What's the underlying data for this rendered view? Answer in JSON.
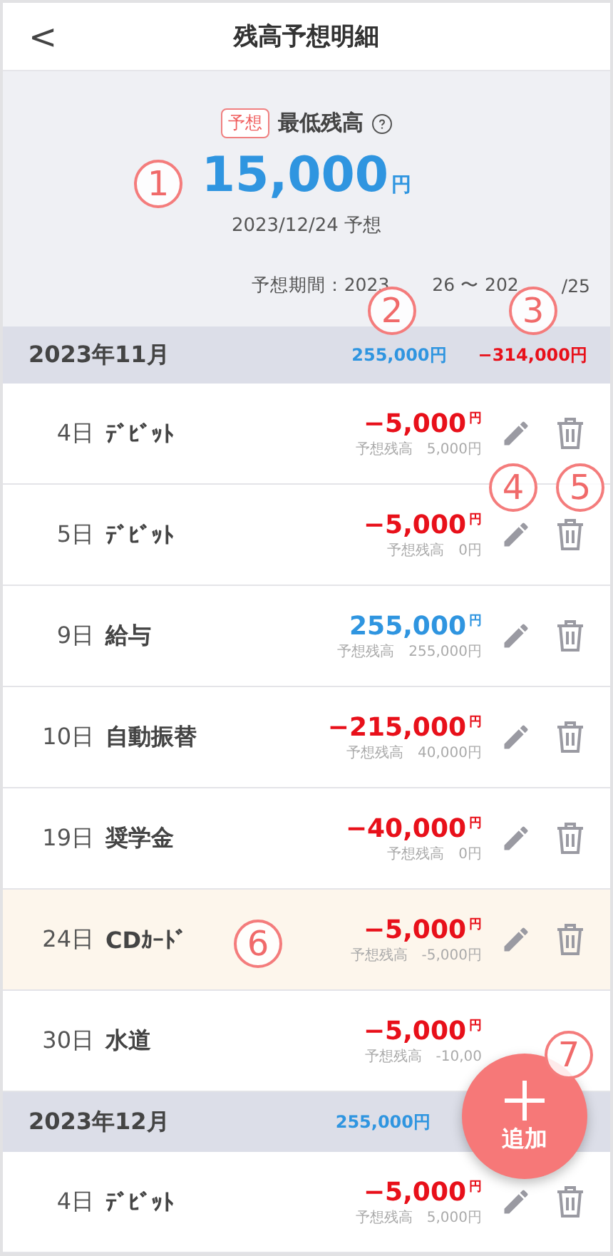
{
  "header": {
    "back": "<",
    "title": "残高予想明細"
  },
  "summary": {
    "badge": "予想",
    "label": "最低残高",
    "amount": "15,000",
    "unit": "円",
    "date": "2023/12/24 予想",
    "period_parts": [
      "予想期間：2023",
      "26 〜 202",
      "/25"
    ]
  },
  "months": [
    {
      "title": "2023年11月",
      "income": "255,000円",
      "expense": "−314,000円",
      "rows": [
        {
          "day": "4日",
          "name": "ﾃﾞﾋﾞｯﾄ",
          "amount": "−5,000",
          "unit": "円",
          "kind": "expense",
          "forecast": "予想残高　5,000円",
          "highlighted": false,
          "actions_visible": true
        },
        {
          "day": "5日",
          "name": "ﾃﾞﾋﾞｯﾄ",
          "amount": "−5,000",
          "unit": "円",
          "kind": "expense",
          "forecast": "予想残高　0円",
          "highlighted": false,
          "actions_visible": true
        },
        {
          "day": "9日",
          "name": "給与",
          "amount": "255,000",
          "unit": "円",
          "kind": "income",
          "forecast": "予想残高　255,000円",
          "highlighted": false,
          "actions_visible": true
        },
        {
          "day": "10日",
          "name": "自動振替",
          "amount": "−215,000",
          "unit": "円",
          "kind": "expense",
          "forecast": "予想残高　40,000円",
          "highlighted": false,
          "actions_visible": true
        },
        {
          "day": "19日",
          "name": "奨学金",
          "amount": "−40,000",
          "unit": "円",
          "kind": "expense",
          "forecast": "予想残高　0円",
          "highlighted": false,
          "actions_visible": true
        },
        {
          "day": "24日",
          "name": "CDｶｰﾄﾞ",
          "amount": "−5,000",
          "unit": "円",
          "kind": "expense",
          "forecast": "予想残高　-5,000円",
          "highlighted": true,
          "actions_visible": true
        },
        {
          "day": "30日",
          "name": "水道",
          "amount": "−5,000",
          "unit": "円",
          "kind": "expense",
          "forecast": "予想残高　-10,00",
          "highlighted": false,
          "actions_visible": false
        }
      ]
    },
    {
      "title": "2023年12月",
      "income": "255,000円",
      "rows": [
        {
          "day": "4日",
          "name": "ﾃﾞﾋﾞｯﾄ",
          "amount": "−5,000",
          "unit": "円",
          "kind": "expense",
          "forecast": "予想残高　5,000円",
          "highlighted": false,
          "actions_visible": true
        }
      ]
    }
  ],
  "fab": {
    "label": "追加"
  },
  "callouts": [
    "1",
    "2",
    "3",
    "4",
    "5",
    "6",
    "7"
  ]
}
